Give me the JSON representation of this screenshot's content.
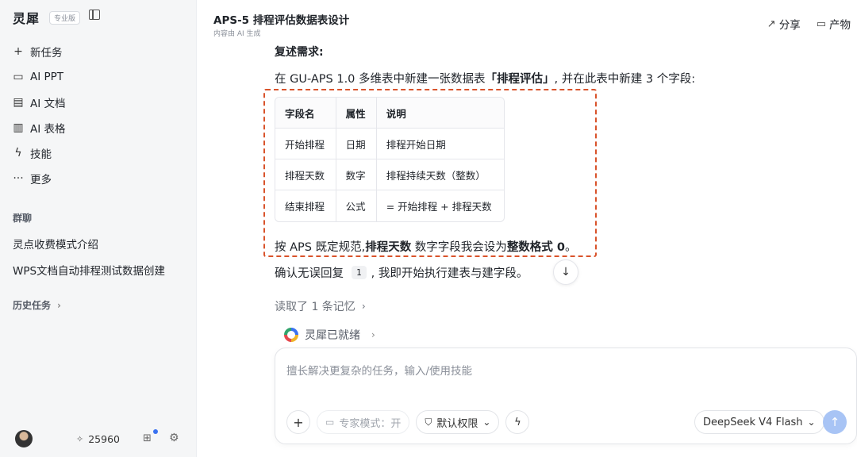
{
  "sidebar": {
    "brand": "灵犀",
    "badge": "专业版",
    "nav": [
      {
        "icon": "+",
        "label": "新任务"
      },
      {
        "icon": "▭",
        "label": "AI PPT"
      },
      {
        "icon": "▤",
        "label": "AI 文档"
      },
      {
        "icon": "▥",
        "label": "AI 表格"
      },
      {
        "icon": "ϟ",
        "label": "技能"
      },
      {
        "icon": "···",
        "label": "更多"
      }
    ],
    "group_title": "群聊",
    "groups": [
      "灵点收费模式介绍",
      "WPS文档自动排程测试数据创建"
    ],
    "history_title": "历史任务",
    "credits": "25960"
  },
  "header": {
    "title": "APS-5 排程评估数据表设计",
    "subtitle": "内容由 AI 生成",
    "share": "分享",
    "artifacts": "产物"
  },
  "message": {
    "heading": "复述需求:",
    "intro_before": "在 GU-APS 1.0 多维表中新建一张数据表",
    "intro_bold": "「排程评估」",
    "intro_after": ", 并在此表中新建 3 个字段:",
    "table": {
      "headers": [
        "字段名",
        "属性",
        "说明"
      ],
      "rows": [
        [
          "开始排程",
          "日期",
          "排程开始日期"
        ],
        [
          "排程天数",
          "数字",
          "排程持续天数（整数）"
        ],
        [
          "结束排程",
          "公式",
          "= 开始排程 + 排程天数"
        ]
      ]
    },
    "note_before": "按 APS 既定规范,",
    "note_bold1": "排程天数",
    "note_mid": " 数字字段我会设为",
    "note_bold2": "整数格式 0",
    "note_after": "。",
    "confirm_before": "确认无误回复",
    "confirm_code": "1",
    "confirm_after": ", 我即开始执行建表与建字段。"
  },
  "memory": "读取了 1 条记忆",
  "ready": "灵犀已就绪",
  "composer": {
    "placeholder": "擅长解决更复杂的任务，输入/使用技能",
    "expert_mode": "专家模式：开",
    "permission": "默认权限",
    "model": "DeepSeek V4 Flash"
  }
}
